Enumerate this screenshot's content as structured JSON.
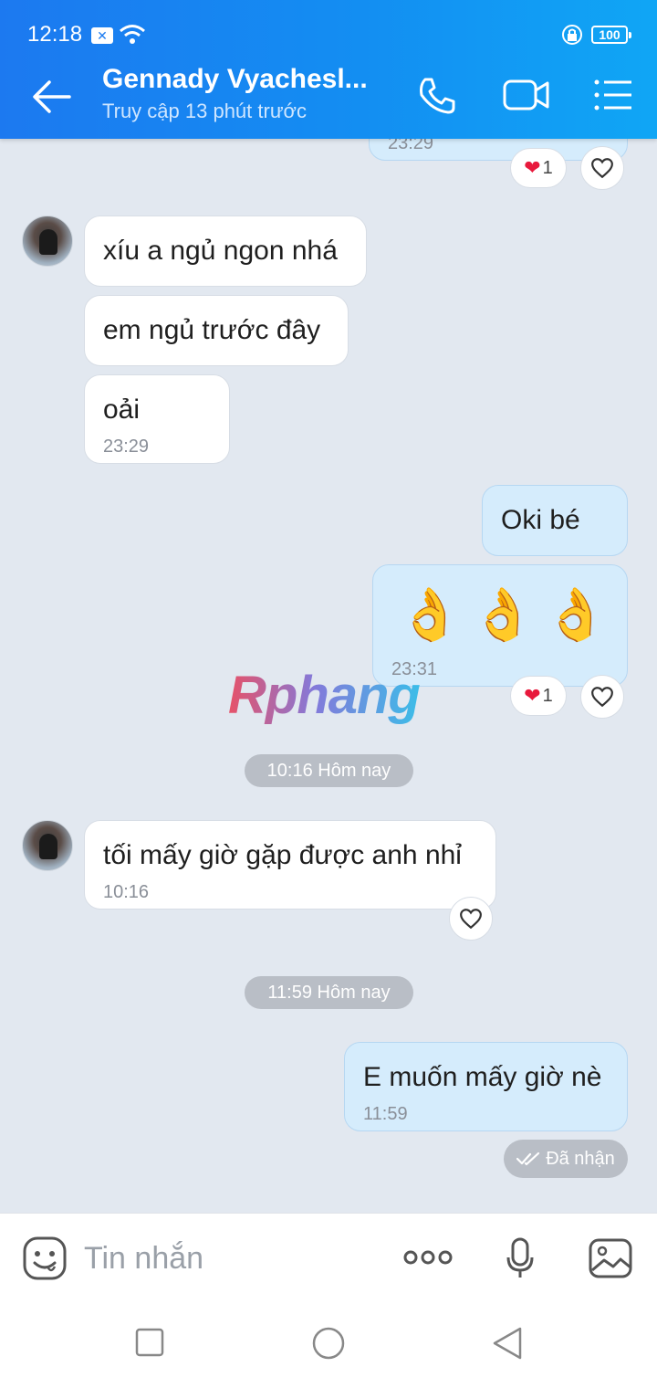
{
  "status": {
    "time": "12:18",
    "battery": "100"
  },
  "header": {
    "contact_name": "Gennady Vyachesl...",
    "last_seen": "Truy cập 13 phút trước",
    "icons": [
      "back-arrow-icon",
      "phone-icon",
      "video-call-icon",
      "menu-list-icon"
    ]
  },
  "messages": {
    "top_partial_time": "23:29",
    "top_reaction_count": "1",
    "in1": "xíu a ngủ ngon nhá",
    "in2": "em ngủ trước đây",
    "in3": "oải",
    "in3_time": "23:29",
    "out1": "Oki bé",
    "out2_emoji": "👌",
    "out2_time": "23:31",
    "out2_reaction_count": "1",
    "divider1": "10:16 Hôm nay",
    "in4": "tối mấy giờ gặp được anh nhỉ",
    "in4_time": "10:16",
    "divider2": "11:59 Hôm nay",
    "out3": "E muốn mấy giờ nè",
    "out3_time": "11:59",
    "delivery_status": "Đã nhận"
  },
  "watermark": "Rphang",
  "input": {
    "placeholder": "Tin nhắn"
  },
  "colors": {
    "header_start": "#1c79f0",
    "header_end": "#10a6f5",
    "out_bubble": "#d5ecfc",
    "in_bubble": "#ffffff",
    "chat_bg": "#e2e8f0"
  }
}
